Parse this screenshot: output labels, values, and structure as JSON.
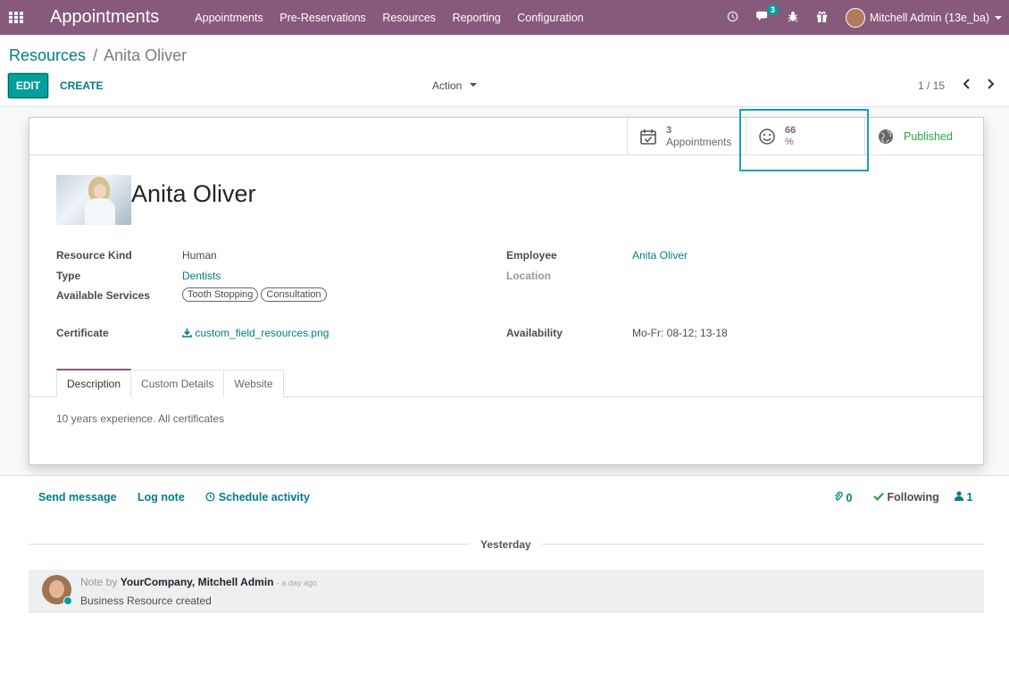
{
  "topbar": {
    "app_title": "Appointments",
    "menu": [
      "Appointments",
      "Pre-Reservations",
      "Resources",
      "Reporting",
      "Configuration"
    ],
    "messages_count": "3",
    "user_name": "Mitchell Admin (13e_ba)"
  },
  "control_panel": {
    "breadcrumb_root": "Resources",
    "breadcrumb_sep": "/",
    "breadcrumb_current": "Anita Oliver",
    "edit_label": "EDIT",
    "create_label": "CREATE",
    "action_label": "Action",
    "pager": "1 / 15"
  },
  "button_box": {
    "appointments_value": "3",
    "appointments_label": "Appointments",
    "rating_value": "66",
    "rating_label": "%",
    "published_label": "Published"
  },
  "record": {
    "name": "Anita Oliver",
    "fields": {
      "resource_kind_label": "Resource Kind",
      "resource_kind_value": "Human",
      "type_label": "Type",
      "type_value": "Dentists",
      "services_label": "Available Services",
      "services": [
        "Tooth Stopping",
        "Consultation"
      ],
      "employee_label": "Employee",
      "employee_value": "Anita Oliver",
      "location_label": "Location",
      "certificate_label": "Certificate",
      "certificate_value": "custom_field_resources.png",
      "availability_label": "Availability",
      "availability_value": "Mo-Fr: 08-12; 13-18"
    },
    "tabs": [
      "Description",
      "Custom Details",
      "Website"
    ],
    "description": "10 years experience. All certificates"
  },
  "chatter": {
    "send_message": "Send message",
    "log_note": "Log note",
    "schedule_activity": "Schedule activity",
    "attachments_count": "0",
    "following_label": "Following",
    "followers_count": "1",
    "separator": "Yesterday",
    "message": {
      "prefix": "Note by",
      "author": "YourCompany, Mitchell Admin",
      "time": "- a day ago",
      "body": "Business Resource created"
    }
  },
  "colors": {
    "topbar": "#875a7b",
    "primary": "#00a09d",
    "link": "#017e84",
    "success": "#28a745",
    "highlight": "#17a2b8"
  }
}
